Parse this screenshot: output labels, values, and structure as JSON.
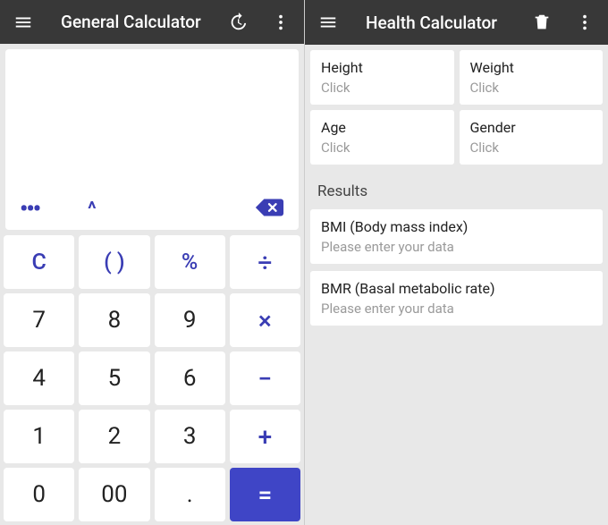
{
  "left": {
    "title": "General Calculator",
    "display": "",
    "controls": {
      "more": "•••",
      "caret": "^"
    },
    "keys": [
      {
        "name": "clear",
        "label": "C",
        "cls": "fn"
      },
      {
        "name": "parens",
        "label": "( )",
        "cls": "fn"
      },
      {
        "name": "percent",
        "label": "%",
        "cls": "fn"
      },
      {
        "name": "divide",
        "label": "÷",
        "cls": "op"
      },
      {
        "name": "seven",
        "label": "7",
        "cls": ""
      },
      {
        "name": "eight",
        "label": "8",
        "cls": ""
      },
      {
        "name": "nine",
        "label": "9",
        "cls": ""
      },
      {
        "name": "multiply",
        "label": "×",
        "cls": "op"
      },
      {
        "name": "four",
        "label": "4",
        "cls": ""
      },
      {
        "name": "five",
        "label": "5",
        "cls": ""
      },
      {
        "name": "six",
        "label": "6",
        "cls": ""
      },
      {
        "name": "minus",
        "label": "−",
        "cls": "op"
      },
      {
        "name": "one",
        "label": "1",
        "cls": ""
      },
      {
        "name": "two",
        "label": "2",
        "cls": ""
      },
      {
        "name": "three",
        "label": "3",
        "cls": ""
      },
      {
        "name": "plus",
        "label": "+",
        "cls": "op"
      },
      {
        "name": "zero",
        "label": "0",
        "cls": ""
      },
      {
        "name": "dbl-zero",
        "label": "00",
        "cls": ""
      },
      {
        "name": "dot",
        "label": ".",
        "cls": ""
      },
      {
        "name": "equals",
        "label": "=",
        "cls": "eq"
      }
    ]
  },
  "right": {
    "title": "Health Calculator",
    "inputs": [
      {
        "name": "height",
        "label": "Height",
        "value": "Click"
      },
      {
        "name": "weight",
        "label": "Weight",
        "value": "Click"
      },
      {
        "name": "age",
        "label": "Age",
        "value": "Click"
      },
      {
        "name": "gender",
        "label": "Gender",
        "value": "Click"
      }
    ],
    "results_title": "Results",
    "results": [
      {
        "name": "bmi",
        "label": "BMI (Body mass index)",
        "value": "Please enter your data"
      },
      {
        "name": "bmr",
        "label": "BMR (Basal metabolic rate)",
        "value": "Please enter your data"
      }
    ]
  }
}
